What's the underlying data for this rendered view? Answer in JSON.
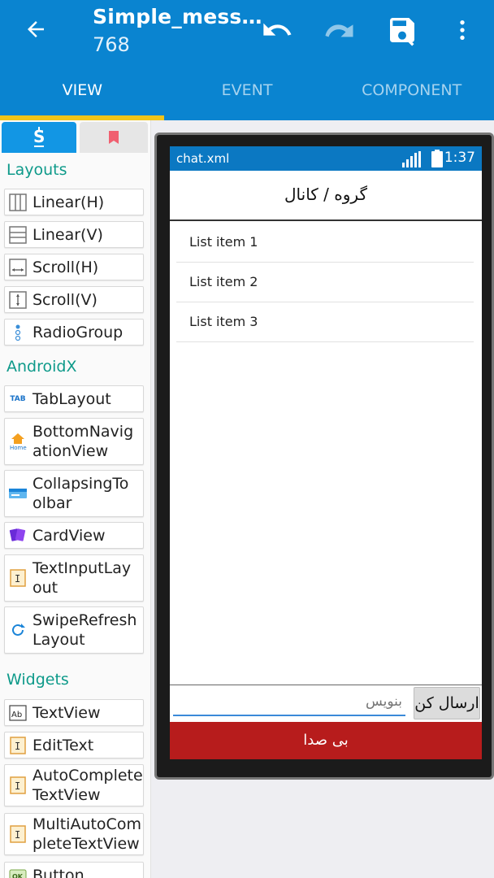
{
  "appbar": {
    "title": "Simple_mess…",
    "subtitle": "768",
    "icons": [
      "back-arrow-icon",
      "undo-icon",
      "redo-icon",
      "save-icon",
      "more-vert-icon"
    ],
    "color": "#0a84d0"
  },
  "tabs": [
    {
      "label": "VIEW",
      "active": true
    },
    {
      "label": "EVENT",
      "active": false
    },
    {
      "label": "COMPONENT",
      "active": false
    }
  ],
  "palette": {
    "sections": {
      "layouts": "Layouts",
      "androidx": "AndroidX",
      "widgets": "Widgets"
    },
    "items": [
      {
        "label": "Linear(H)",
        "icon": "linear-horizontal-icon"
      },
      {
        "label": "Linear(V)",
        "icon": "linear-vertical-icon"
      },
      {
        "label": "Scroll(H)",
        "icon": "scroll-horizontal-icon"
      },
      {
        "label": "Scroll(V)",
        "icon": "scroll-vertical-icon"
      },
      {
        "label": "RadioGroup",
        "icon": "radiogroup-icon"
      },
      {
        "label": "TabLayout",
        "icon": "tablayout-icon",
        "tag": "TAB"
      },
      {
        "label": "BottomNavigationView",
        "icon": "bottom-navigation-icon",
        "tag": "Home"
      },
      {
        "label": "CollapsingToolbar",
        "icon": "collapsing-toolbar-icon"
      },
      {
        "label": "CardView",
        "icon": "cardview-icon"
      },
      {
        "label": "TextInputLayout",
        "icon": "text-input-layout-icon"
      },
      {
        "label": "SwipeRefreshLayout",
        "icon": "swipe-refresh-icon"
      },
      {
        "label": "TextView",
        "icon": "textview-icon",
        "tag": "Ab"
      },
      {
        "label": "EditText",
        "icon": "edittext-icon"
      },
      {
        "label": "AutoCompleteTextView",
        "icon": "autocomplete-icon"
      },
      {
        "label": "MultiAutoCompleteTextView",
        "icon": "multi-autocomplete-icon"
      },
      {
        "label": "Button",
        "icon": "button-icon",
        "tag": "OK"
      }
    ]
  },
  "preview": {
    "filename": "chat.xml",
    "time": "1:37",
    "chat_title": "گروه / کانال",
    "list_items": [
      "List item 1",
      "List item 2",
      "List item 3"
    ],
    "input_placeholder": "بنویس",
    "send_label": "ارسال کن",
    "bottom_label": "بی صدا",
    "statusbar_color": "#0b78c2",
    "bottom_color": "#b71c1c"
  }
}
